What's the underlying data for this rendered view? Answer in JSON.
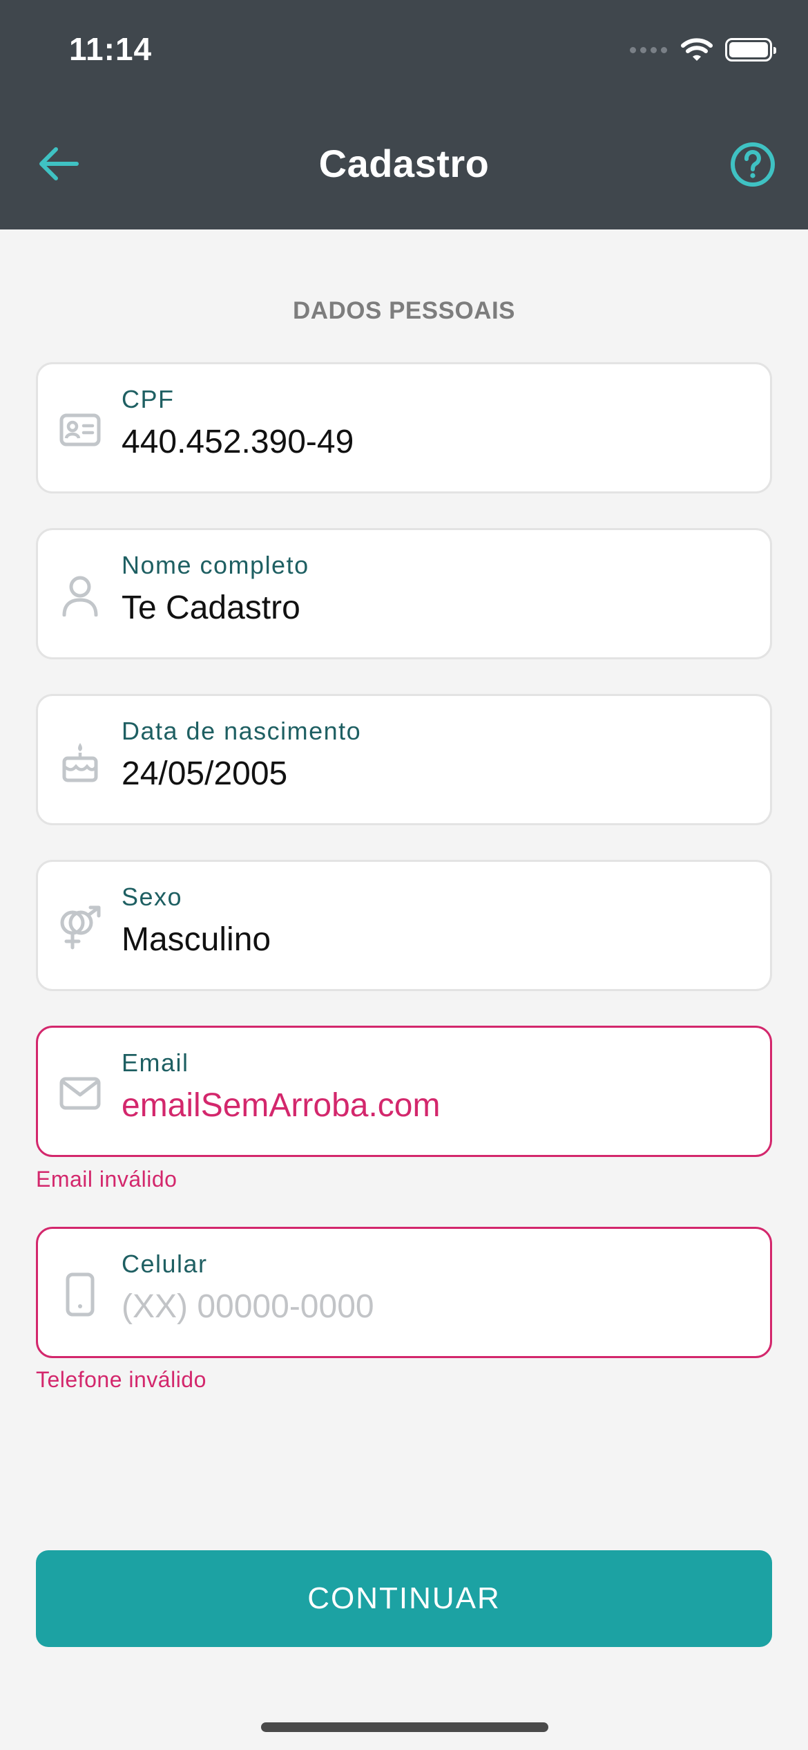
{
  "status_bar": {
    "time": "11:14"
  },
  "header": {
    "title": "Cadastro"
  },
  "section": {
    "title": "DADOS PESSOAIS"
  },
  "fields": {
    "cpf": {
      "label": "CPF",
      "value": "440.452.390-49"
    },
    "nome": {
      "label": "Nome completo",
      "value": "Te Cadastro"
    },
    "nascimento": {
      "label": "Data de nascimento",
      "value": "24/05/2005"
    },
    "sexo": {
      "label": "Sexo",
      "value": "Masculino"
    },
    "email": {
      "label": "Email",
      "value": "emailSemArroba.com",
      "error": "Email inválido"
    },
    "celular": {
      "label": "Celular",
      "value": "",
      "placeholder": "(XX) 00000-0000",
      "error": "Telefone inválido"
    }
  },
  "actions": {
    "continue_label": "CONTINUAR"
  },
  "colors": {
    "header_bg": "#40474d",
    "accent": "#1ca2a3",
    "error": "#d3276c",
    "label": "#1e5f62",
    "background": "#f4f4f4"
  },
  "icons": {
    "back": "arrow-left-icon",
    "help": "help-circle-icon",
    "cpf": "id-card-icon",
    "nome": "user-icon",
    "nascimento": "cake-icon",
    "sexo": "gender-icon",
    "email": "mail-icon",
    "celular": "phone-icon"
  }
}
